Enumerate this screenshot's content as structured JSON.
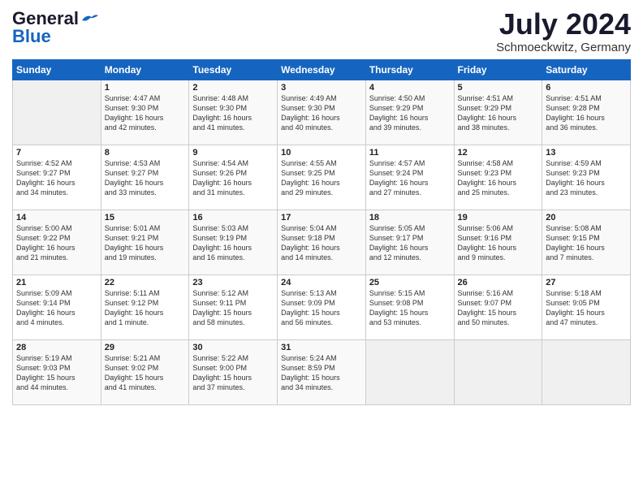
{
  "logo": {
    "line1": "General",
    "line2": "Blue"
  },
  "header": {
    "month": "July 2024",
    "location": "Schmoeckwitz, Germany"
  },
  "days_of_week": [
    "Sunday",
    "Monday",
    "Tuesday",
    "Wednesday",
    "Thursday",
    "Friday",
    "Saturday"
  ],
  "weeks": [
    [
      {
        "day": "",
        "info": ""
      },
      {
        "day": "1",
        "info": "Sunrise: 4:47 AM\nSunset: 9:30 PM\nDaylight: 16 hours\nand 42 minutes."
      },
      {
        "day": "2",
        "info": "Sunrise: 4:48 AM\nSunset: 9:30 PM\nDaylight: 16 hours\nand 41 minutes."
      },
      {
        "day": "3",
        "info": "Sunrise: 4:49 AM\nSunset: 9:30 PM\nDaylight: 16 hours\nand 40 minutes."
      },
      {
        "day": "4",
        "info": "Sunrise: 4:50 AM\nSunset: 9:29 PM\nDaylight: 16 hours\nand 39 minutes."
      },
      {
        "day": "5",
        "info": "Sunrise: 4:51 AM\nSunset: 9:29 PM\nDaylight: 16 hours\nand 38 minutes."
      },
      {
        "day": "6",
        "info": "Sunrise: 4:51 AM\nSunset: 9:28 PM\nDaylight: 16 hours\nand 36 minutes."
      }
    ],
    [
      {
        "day": "7",
        "info": "Sunrise: 4:52 AM\nSunset: 9:27 PM\nDaylight: 16 hours\nand 34 minutes."
      },
      {
        "day": "8",
        "info": "Sunrise: 4:53 AM\nSunset: 9:27 PM\nDaylight: 16 hours\nand 33 minutes."
      },
      {
        "day": "9",
        "info": "Sunrise: 4:54 AM\nSunset: 9:26 PM\nDaylight: 16 hours\nand 31 minutes."
      },
      {
        "day": "10",
        "info": "Sunrise: 4:55 AM\nSunset: 9:25 PM\nDaylight: 16 hours\nand 29 minutes."
      },
      {
        "day": "11",
        "info": "Sunrise: 4:57 AM\nSunset: 9:24 PM\nDaylight: 16 hours\nand 27 minutes."
      },
      {
        "day": "12",
        "info": "Sunrise: 4:58 AM\nSunset: 9:23 PM\nDaylight: 16 hours\nand 25 minutes."
      },
      {
        "day": "13",
        "info": "Sunrise: 4:59 AM\nSunset: 9:23 PM\nDaylight: 16 hours\nand 23 minutes."
      }
    ],
    [
      {
        "day": "14",
        "info": "Sunrise: 5:00 AM\nSunset: 9:22 PM\nDaylight: 16 hours\nand 21 minutes."
      },
      {
        "day": "15",
        "info": "Sunrise: 5:01 AM\nSunset: 9:21 PM\nDaylight: 16 hours\nand 19 minutes."
      },
      {
        "day": "16",
        "info": "Sunrise: 5:03 AM\nSunset: 9:19 PM\nDaylight: 16 hours\nand 16 minutes."
      },
      {
        "day": "17",
        "info": "Sunrise: 5:04 AM\nSunset: 9:18 PM\nDaylight: 16 hours\nand 14 minutes."
      },
      {
        "day": "18",
        "info": "Sunrise: 5:05 AM\nSunset: 9:17 PM\nDaylight: 16 hours\nand 12 minutes."
      },
      {
        "day": "19",
        "info": "Sunrise: 5:06 AM\nSunset: 9:16 PM\nDaylight: 16 hours\nand 9 minutes."
      },
      {
        "day": "20",
        "info": "Sunrise: 5:08 AM\nSunset: 9:15 PM\nDaylight: 16 hours\nand 7 minutes."
      }
    ],
    [
      {
        "day": "21",
        "info": "Sunrise: 5:09 AM\nSunset: 9:14 PM\nDaylight: 16 hours\nand 4 minutes."
      },
      {
        "day": "22",
        "info": "Sunrise: 5:11 AM\nSunset: 9:12 PM\nDaylight: 16 hours\nand 1 minute."
      },
      {
        "day": "23",
        "info": "Sunrise: 5:12 AM\nSunset: 9:11 PM\nDaylight: 15 hours\nand 58 minutes."
      },
      {
        "day": "24",
        "info": "Sunrise: 5:13 AM\nSunset: 9:09 PM\nDaylight: 15 hours\nand 56 minutes."
      },
      {
        "day": "25",
        "info": "Sunrise: 5:15 AM\nSunset: 9:08 PM\nDaylight: 15 hours\nand 53 minutes."
      },
      {
        "day": "26",
        "info": "Sunrise: 5:16 AM\nSunset: 9:07 PM\nDaylight: 15 hours\nand 50 minutes."
      },
      {
        "day": "27",
        "info": "Sunrise: 5:18 AM\nSunset: 9:05 PM\nDaylight: 15 hours\nand 47 minutes."
      }
    ],
    [
      {
        "day": "28",
        "info": "Sunrise: 5:19 AM\nSunset: 9:03 PM\nDaylight: 15 hours\nand 44 minutes."
      },
      {
        "day": "29",
        "info": "Sunrise: 5:21 AM\nSunset: 9:02 PM\nDaylight: 15 hours\nand 41 minutes."
      },
      {
        "day": "30",
        "info": "Sunrise: 5:22 AM\nSunset: 9:00 PM\nDaylight: 15 hours\nand 37 minutes."
      },
      {
        "day": "31",
        "info": "Sunrise: 5:24 AM\nSunset: 8:59 PM\nDaylight: 15 hours\nand 34 minutes."
      },
      {
        "day": "",
        "info": ""
      },
      {
        "day": "",
        "info": ""
      },
      {
        "day": "",
        "info": ""
      }
    ]
  ]
}
